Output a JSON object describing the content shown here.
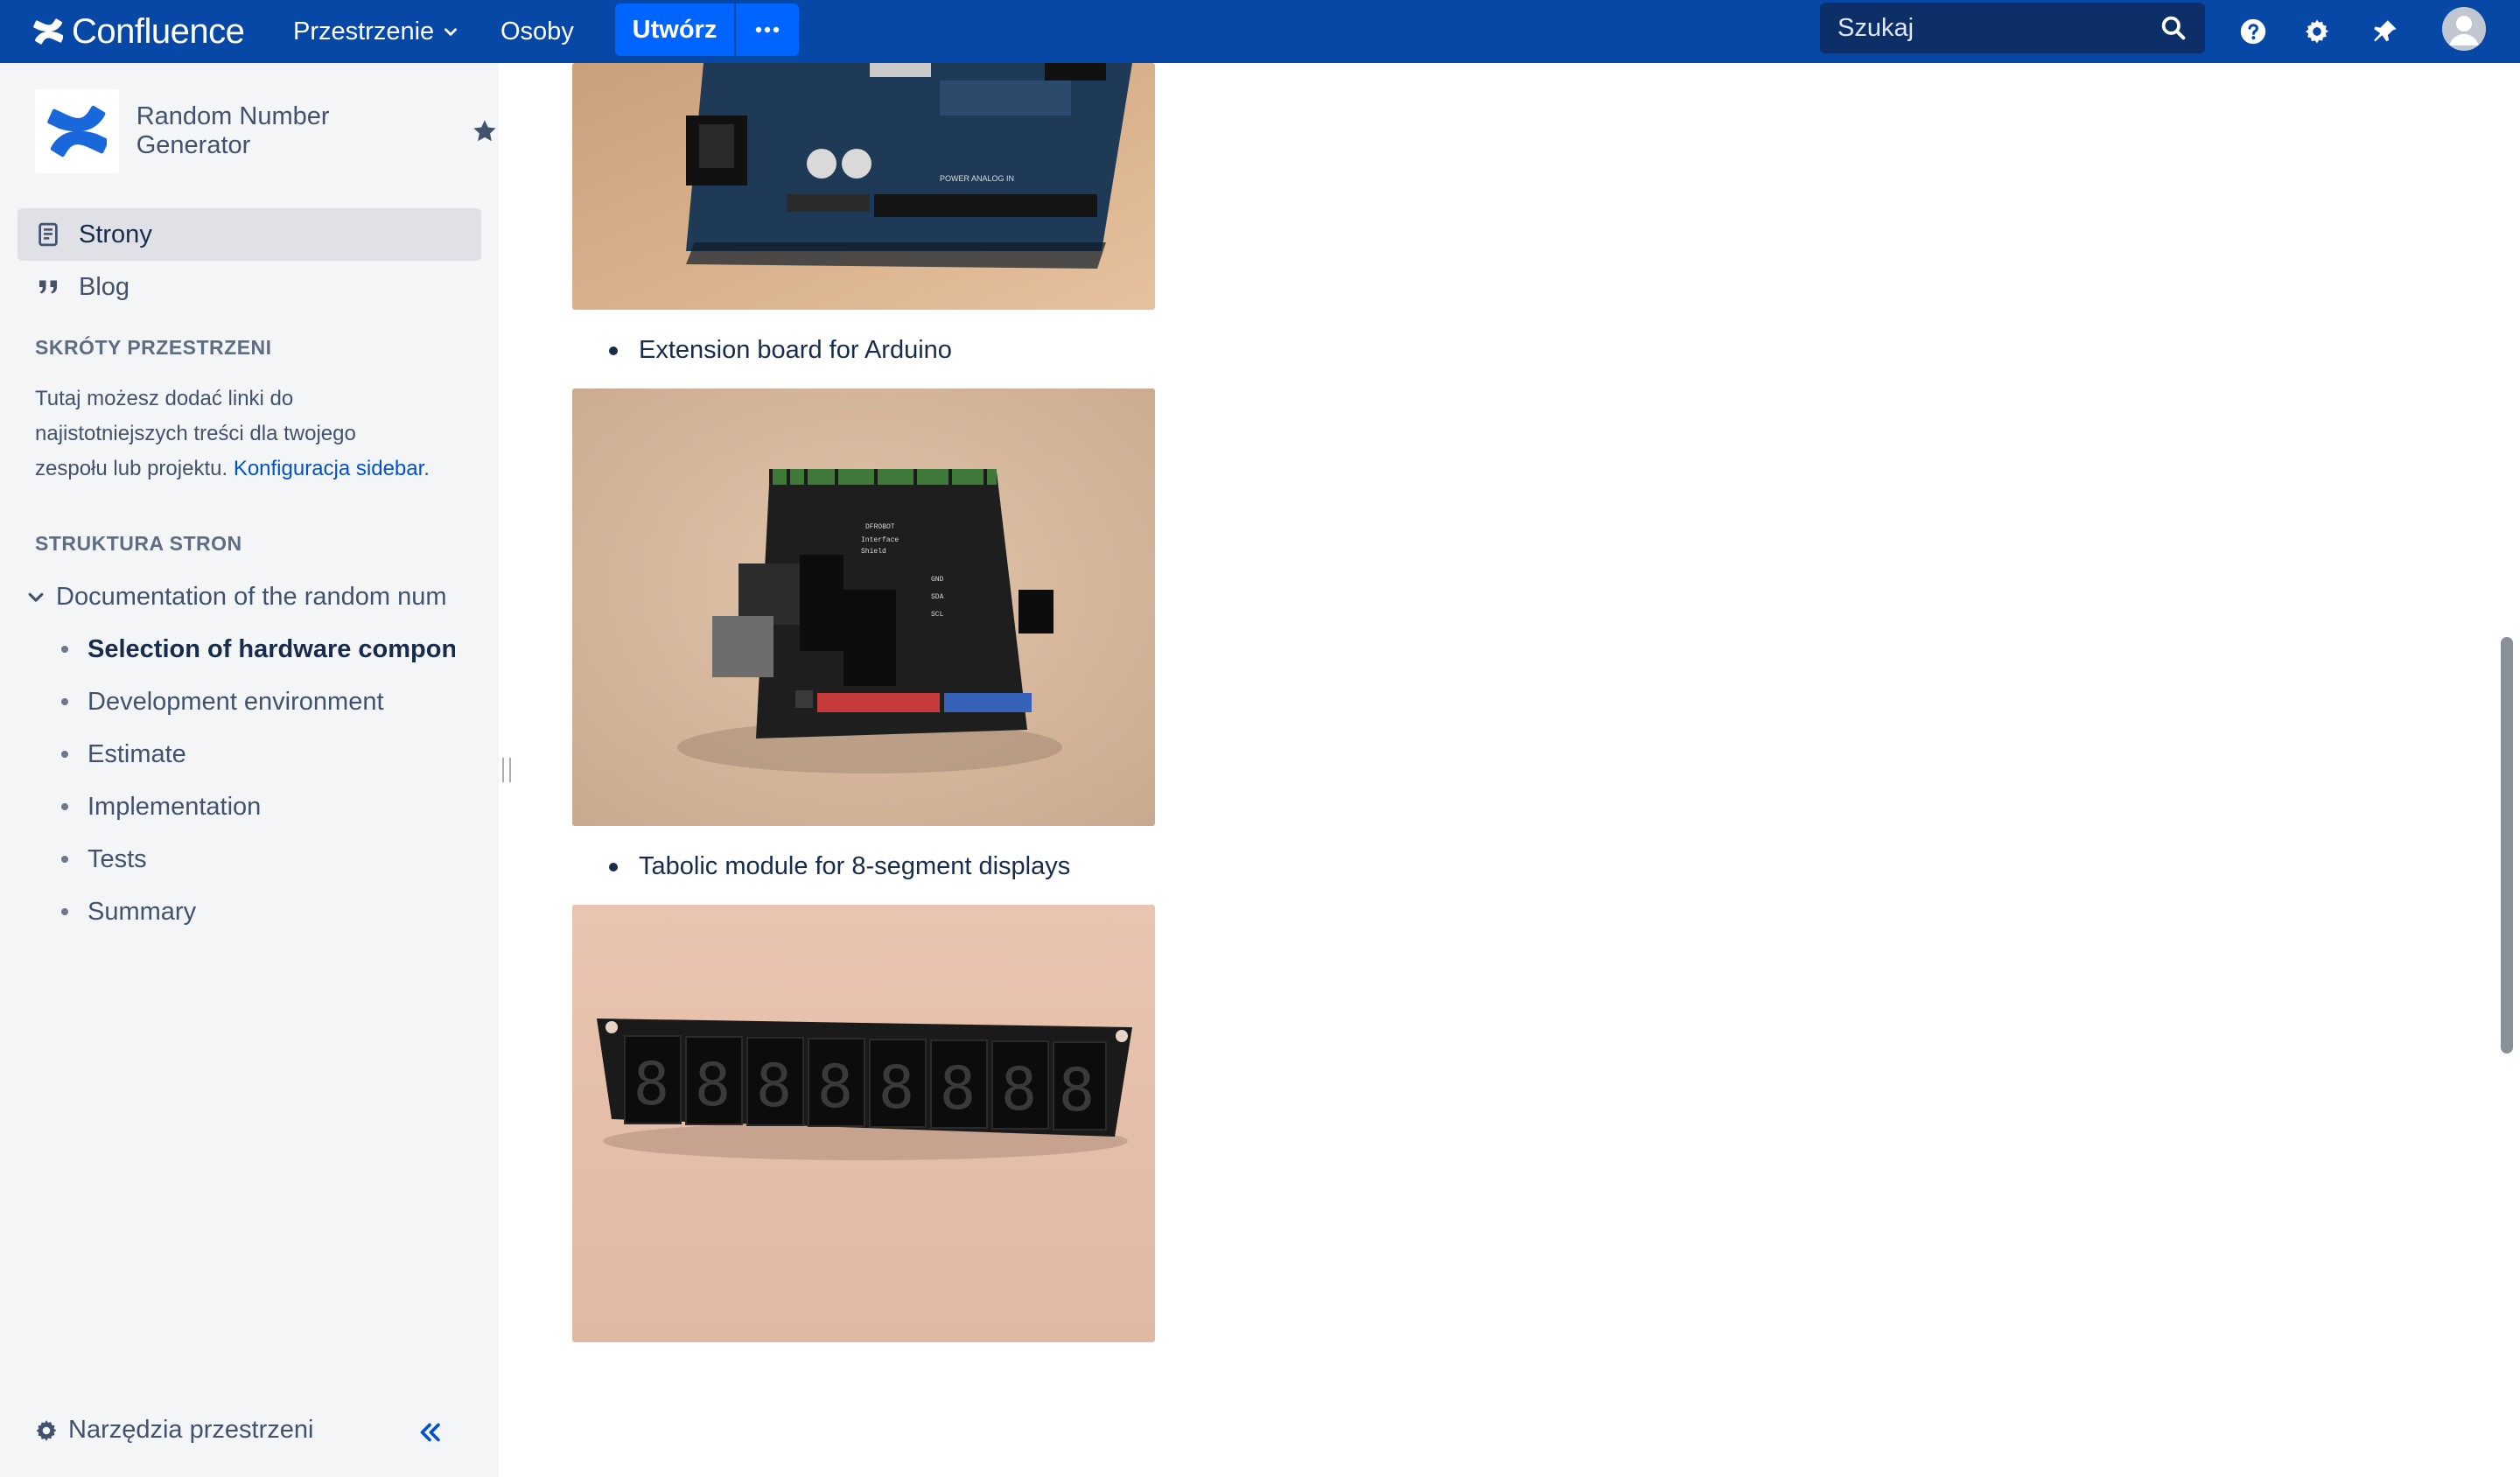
{
  "app": {
    "name": "Confluence",
    "brand_color": "#0747a6",
    "accent_color": "#0065ff"
  },
  "topnav": {
    "spaces_label": "Przestrzenie",
    "people_label": "Osoby",
    "create_label": "Utwórz",
    "more_icon": "more-horizontal-icon",
    "search_placeholder": "Szukaj",
    "icons": [
      "search-icon",
      "help-icon",
      "gear-icon",
      "notification-icon",
      "avatar"
    ]
  },
  "sidebar": {
    "space_name": "Random Number Generator",
    "nav": [
      {
        "label": "Strony",
        "icon": "page-icon",
        "active": true
      },
      {
        "label": "Blog",
        "icon": "quote-icon",
        "active": false
      }
    ],
    "shortcuts_heading": "SKRÓTY PRZESTRZENI",
    "shortcuts_text_1": "Tutaj możesz dodać linki do",
    "shortcuts_text_2": "najistotniejszych treści dla twojego",
    "shortcuts_text_3": "zespołu lub projektu.",
    "shortcuts_link": "Konfiguracja sidebar",
    "shortcuts_text_end": ".",
    "tree_heading": "STRUKTURA STRON",
    "tree_root": "Documentation of the random num",
    "tree_items": [
      {
        "label": "Selection of hardware compon",
        "current": true
      },
      {
        "label": "Development environment",
        "current": false
      },
      {
        "label": "Estimate",
        "current": false
      },
      {
        "label": "Implementation",
        "current": false
      },
      {
        "label": "Tests",
        "current": false
      },
      {
        "label": "Summary",
        "current": false
      }
    ],
    "tools_label": "Narzędzia przestrzeni"
  },
  "content": {
    "bullets": [
      "Extension board for Arduino",
      "Tabolic module for 8-segment displays"
    ],
    "images": [
      {
        "alt": "Arduino board photo"
      },
      {
        "alt": "Extension board photo"
      },
      {
        "alt": "8-segment display module photo"
      }
    ]
  }
}
